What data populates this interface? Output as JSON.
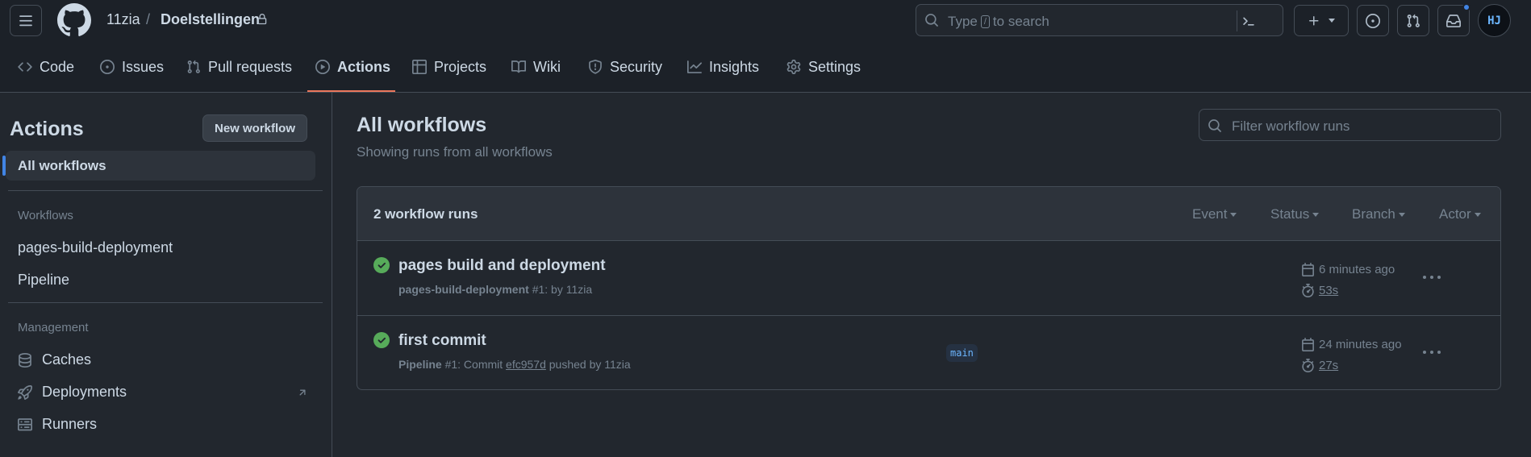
{
  "header": {
    "owner": "11zia",
    "separator": "/",
    "repo": "Doelstellingen",
    "search_prefix": "Type",
    "search_key": "/",
    "search_suffix": "to search",
    "avatar_text": "HJ"
  },
  "repo_nav": {
    "tabs": [
      {
        "label": "Code",
        "icon": "code-icon"
      },
      {
        "label": "Issues",
        "icon": "issue-opened-icon"
      },
      {
        "label": "Pull requests",
        "icon": "git-pull-request-icon"
      },
      {
        "label": "Actions",
        "icon": "play-icon",
        "active": true
      },
      {
        "label": "Projects",
        "icon": "table-icon"
      },
      {
        "label": "Wiki",
        "icon": "book-icon"
      },
      {
        "label": "Security",
        "icon": "shield-icon"
      },
      {
        "label": "Insights",
        "icon": "graph-icon"
      },
      {
        "label": "Settings",
        "icon": "gear-icon"
      }
    ]
  },
  "sidebar": {
    "title": "Actions",
    "new_workflow_label": "New workflow",
    "all_workflows_label": "All workflows",
    "workflows_heading": "Workflows",
    "workflows": [
      "pages-build-deployment",
      "Pipeline"
    ],
    "management_heading": "Management",
    "management": [
      {
        "label": "Caches",
        "icon": "database-icon"
      },
      {
        "label": "Deployments",
        "icon": "rocket-icon"
      },
      {
        "label": "Runners",
        "icon": "server-icon"
      }
    ]
  },
  "main": {
    "title": "All workflows",
    "subtitle": "Showing runs from all workflows",
    "filter_placeholder": "Filter workflow runs",
    "runs_count": "2 workflow runs",
    "filters": [
      "Event",
      "Status",
      "Branch",
      "Actor"
    ],
    "runs": [
      {
        "title": "pages build and deployment",
        "workflow": "pages-build-deployment",
        "meta_rest": "#1: by 11zia",
        "time_ago": "6 minutes ago",
        "duration": "53s",
        "status": "success"
      },
      {
        "title": "first commit",
        "workflow": "Pipeline",
        "meta_mid": "#1: Commit",
        "sha": "efc957d",
        "meta_rest": "pushed by 11zia",
        "branch": "main",
        "time_ago": "24 minutes ago",
        "duration": "27s",
        "status": "success"
      }
    ]
  },
  "colors": {
    "success": "#57ab5a",
    "accent_tab": "#ec775c",
    "link": "#6cb6ff"
  }
}
